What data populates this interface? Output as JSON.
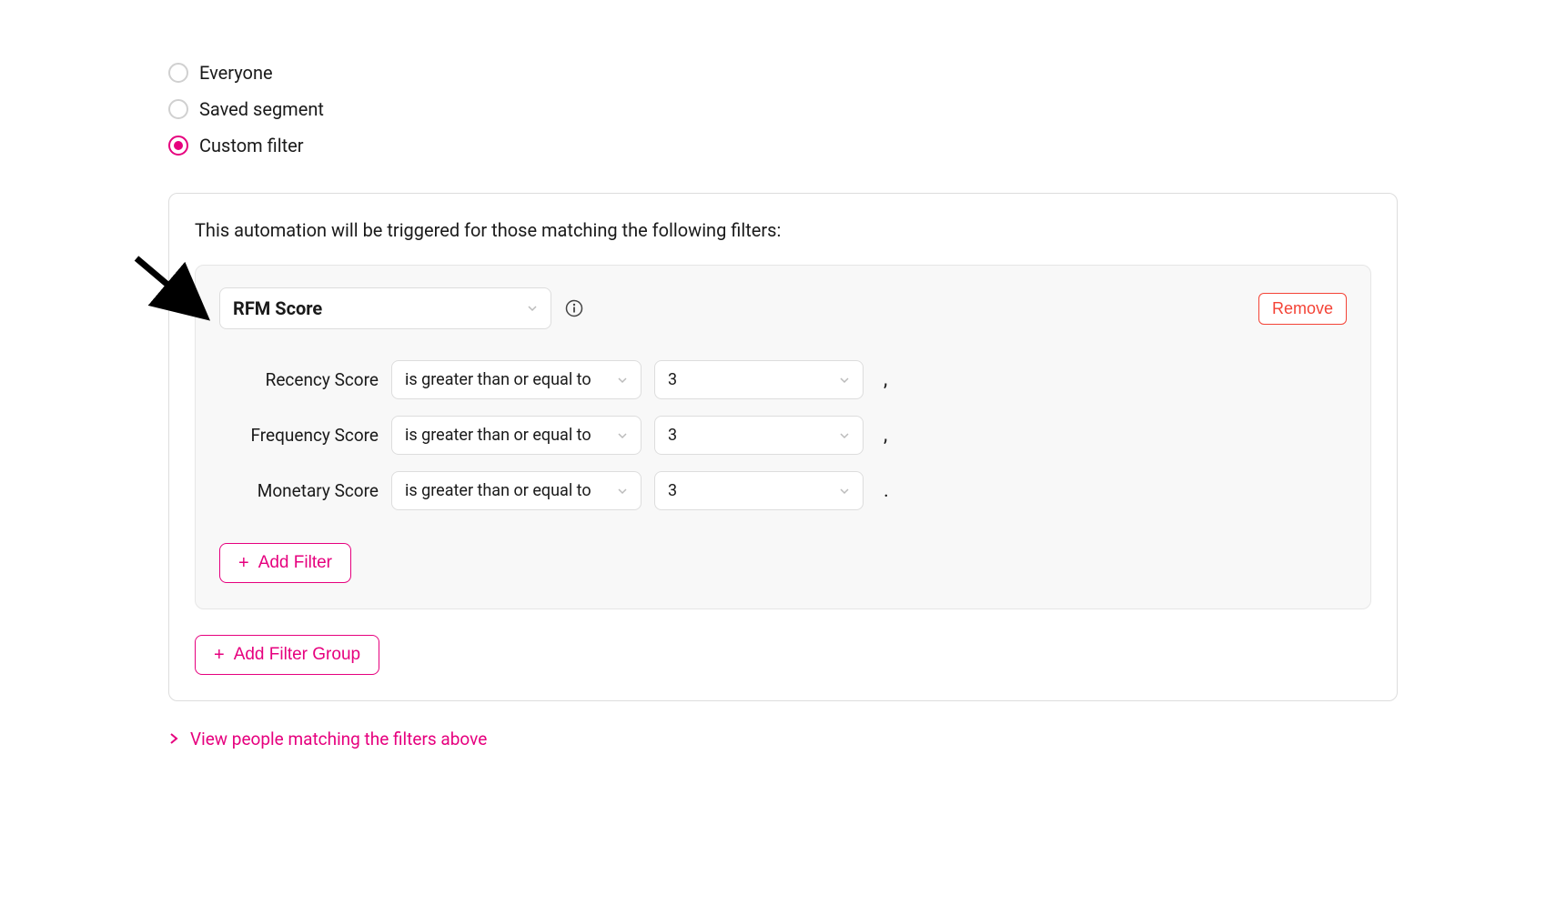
{
  "audience": {
    "options": [
      {
        "key": "everyone",
        "label": "Everyone"
      },
      {
        "key": "saved_segment",
        "label": "Saved segment"
      },
      {
        "key": "custom_filter",
        "label": "Custom filter"
      }
    ],
    "selected": "custom_filter"
  },
  "panel": {
    "description": "This automation will be triggered for those matching the following filters:"
  },
  "filter_group": {
    "type_label": "RFM Score",
    "remove_label": "Remove",
    "rows": [
      {
        "label": "Recency Score",
        "operator": "is greater than or equal to",
        "value": "3",
        "sep": ","
      },
      {
        "label": "Frequency Score",
        "operator": "is greater than or equal to",
        "value": "3",
        "sep": ","
      },
      {
        "label": "Monetary Score",
        "operator": "is greater than or equal to",
        "value": "3",
        "sep": "."
      }
    ],
    "add_filter_label": "Add Filter"
  },
  "add_group_label": "Add Filter Group",
  "view_matching_label": "View people matching the filters above"
}
